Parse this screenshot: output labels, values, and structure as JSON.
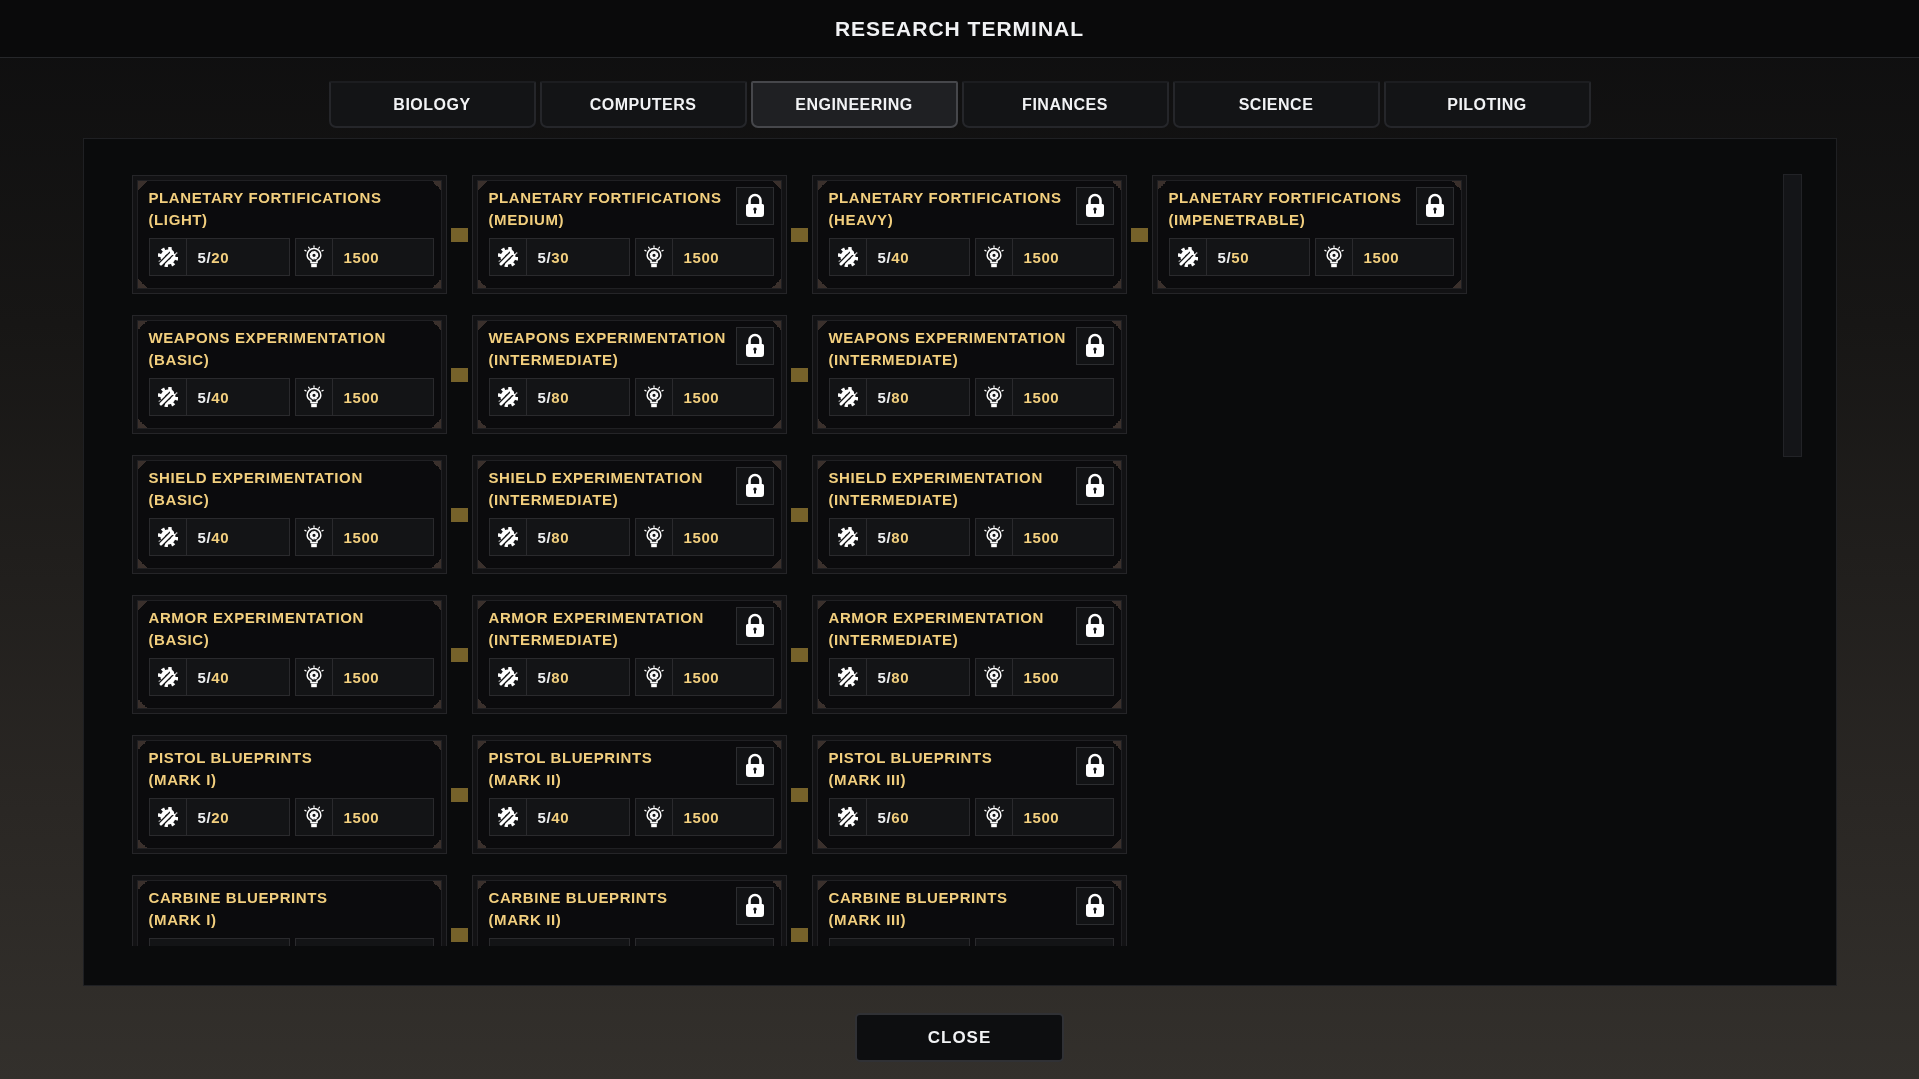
{
  "window": {
    "title": "RESEARCH TERMINAL"
  },
  "tabs": [
    {
      "label": "BIOLOGY",
      "selected": false
    },
    {
      "label": "COMPUTERS",
      "selected": false
    },
    {
      "label": "ENGINEERING",
      "selected": true
    },
    {
      "label": "FINANCES",
      "selected": false
    },
    {
      "label": "SCIENCE",
      "selected": false
    },
    {
      "label": "PILOTING",
      "selected": false
    }
  ],
  "research": {
    "rows": [
      {
        "cards": [
          {
            "name": "PLANETARY FORTIFICATIONS",
            "grade": "(LIGHT)",
            "locked": false,
            "progress": {
              "done": "5/",
              "required": "20"
            },
            "cost": "1500"
          },
          {
            "name": "PLANETARY FORTIFICATIONS",
            "grade": "(MEDIUM)",
            "locked": true,
            "progress": {
              "done": "5/",
              "required": "30"
            },
            "cost": "1500"
          },
          {
            "name": "PLANETARY FORTIFICATIONS",
            "grade": "(HEAVY)",
            "locked": true,
            "progress": {
              "done": "5/",
              "required": "40"
            },
            "cost": "1500"
          },
          {
            "name": "PLANETARY FORTIFICATIONS",
            "grade": "(IMPENETRABLE)",
            "locked": true,
            "progress": {
              "done": "5/",
              "required": "50"
            },
            "cost": "1500"
          }
        ]
      },
      {
        "cards": [
          {
            "name": "WEAPONS EXPERIMENTATION",
            "grade": "(BASIC)",
            "locked": false,
            "progress": {
              "done": "5/",
              "required": "40"
            },
            "cost": "1500"
          },
          {
            "name": "WEAPONS EXPERIMENTATION",
            "grade": "(INTERMEDIATE)",
            "locked": true,
            "progress": {
              "done": "5/",
              "required": "80"
            },
            "cost": "1500"
          },
          {
            "name": "WEAPONS EXPERIMENTATION",
            "grade": "(INTERMEDIATE)",
            "locked": true,
            "progress": {
              "done": "5/",
              "required": "80"
            },
            "cost": "1500"
          }
        ]
      },
      {
        "cards": [
          {
            "name": "SHIELD EXPERIMENTATION",
            "grade": "(BASIC)",
            "locked": false,
            "progress": {
              "done": "5/",
              "required": "40"
            },
            "cost": "1500"
          },
          {
            "name": "SHIELD EXPERIMENTATION",
            "grade": "(INTERMEDIATE)",
            "locked": true,
            "progress": {
              "done": "5/",
              "required": "80"
            },
            "cost": "1500"
          },
          {
            "name": "SHIELD EXPERIMENTATION",
            "grade": "(INTERMEDIATE)",
            "locked": true,
            "progress": {
              "done": "5/",
              "required": "80"
            },
            "cost": "1500"
          }
        ]
      },
      {
        "cards": [
          {
            "name": "ARMOR EXPERIMENTATION",
            "grade": "(BASIC)",
            "locked": false,
            "progress": {
              "done": "5/",
              "required": "40"
            },
            "cost": "1500"
          },
          {
            "name": "ARMOR EXPERIMENTATION",
            "grade": "(INTERMEDIATE)",
            "locked": true,
            "progress": {
              "done": "5/",
              "required": "80"
            },
            "cost": "1500"
          },
          {
            "name": "ARMOR EXPERIMENTATION",
            "grade": "(INTERMEDIATE)",
            "locked": true,
            "progress": {
              "done": "5/",
              "required": "80"
            },
            "cost": "1500"
          }
        ]
      },
      {
        "cards": [
          {
            "name": "PISTOL BLUEPRINTS",
            "grade": "(MARK I)",
            "locked": false,
            "progress": {
              "done": "5/",
              "required": "20"
            },
            "cost": "1500"
          },
          {
            "name": "PISTOL BLUEPRINTS",
            "grade": "(MARK II)",
            "locked": true,
            "progress": {
              "done": "5/",
              "required": "40"
            },
            "cost": "1500"
          },
          {
            "name": "PISTOL BLUEPRINTS",
            "grade": "(MARK III)",
            "locked": true,
            "progress": {
              "done": "5/",
              "required": "60"
            },
            "cost": "1500"
          }
        ]
      },
      {
        "cards": [
          {
            "name": "CARBINE BLUEPRINTS",
            "grade": "(MARK I)",
            "locked": false
          },
          {
            "name": "CARBINE BLUEPRINTS",
            "grade": "(MARK II)",
            "locked": true
          },
          {
            "name": "CARBINE BLUEPRINTS",
            "grade": "(MARK III)",
            "locked": true
          }
        ]
      }
    ]
  },
  "close_button": {
    "label": "CLOSE"
  }
}
